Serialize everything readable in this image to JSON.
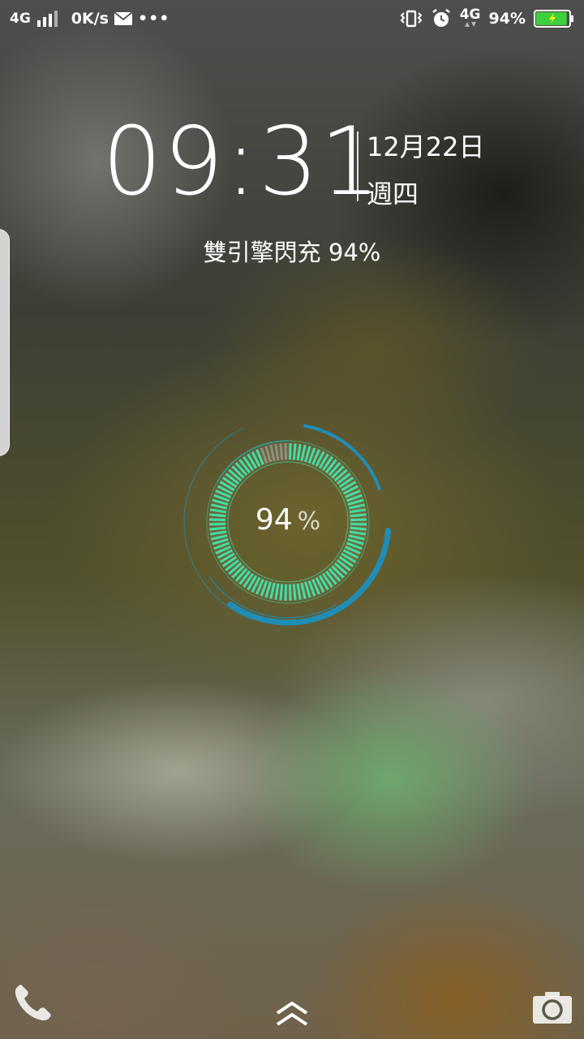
{
  "status_bar": {
    "network_left": "4G",
    "speed": "0K/s",
    "dots": "•••",
    "network_right": "4G",
    "battery_text": "94%",
    "battery_level": 0.94,
    "battery_color": "#3ecf3e"
  },
  "lockscreen": {
    "time": "09:31",
    "date": "12月22日",
    "weekday": "週四",
    "charge_status": "雙引擎閃充 94%"
  },
  "charge_ring": {
    "value": "94",
    "unit": "%",
    "level": 0.94,
    "accent_color": "#3fe0a6",
    "arc_color": "#1f8db5"
  },
  "bottom_bar": {
    "phone_icon": "phone-icon",
    "unlock_icon": "chevron-double-up-icon",
    "camera_icon": "camera-icon"
  }
}
